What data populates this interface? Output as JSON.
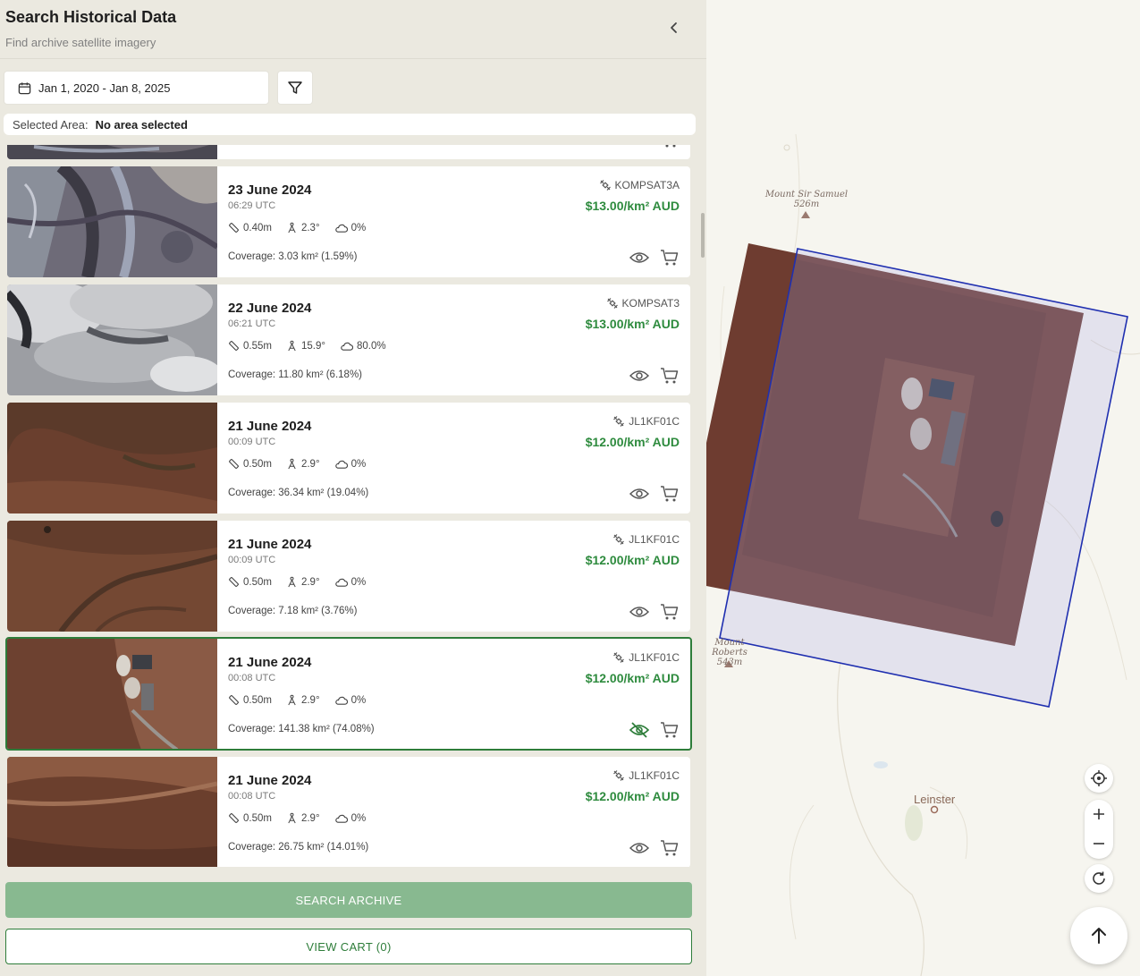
{
  "header": {
    "title": "Search Historical Data",
    "subtitle": "Find archive satellite imagery"
  },
  "filters": {
    "date_range": "Jan 1, 2020 - Jan 8, 2025",
    "selected_area_label": "Selected Area:",
    "selected_area_value": "No area selected"
  },
  "results": [
    {
      "date": "23 June 2024",
      "time": "06:29 UTC",
      "resolution": "0.40m",
      "angle": "2.3°",
      "cloud": "0%",
      "coverage": "Coverage: 3.03 km² (1.59%)",
      "satellite": "KOMPSAT3A",
      "price": "$13.00/km² AUD",
      "visible": true
    },
    {
      "date": "22 June 2024",
      "time": "06:21 UTC",
      "resolution": "0.55m",
      "angle": "15.9°",
      "cloud": "80.0%",
      "coverage": "Coverage: 11.80 km² (6.18%)",
      "satellite": "KOMPSAT3",
      "price": "$13.00/km² AUD",
      "visible": true
    },
    {
      "date": "21 June 2024",
      "time": "00:09 UTC",
      "resolution": "0.50m",
      "angle": "2.9°",
      "cloud": "0%",
      "coverage": "Coverage: 36.34 km² (19.04%)",
      "satellite": "JL1KF01C",
      "price": "$12.00/km² AUD",
      "visible": true
    },
    {
      "date": "21 June 2024",
      "time": "00:09 UTC",
      "resolution": "0.50m",
      "angle": "2.9°",
      "cloud": "0%",
      "coverage": "Coverage: 7.18 km² (3.76%)",
      "satellite": "JL1KF01C",
      "price": "$12.00/km² AUD",
      "visible": true
    },
    {
      "date": "21 June 2024",
      "time": "00:08 UTC",
      "resolution": "0.50m",
      "angle": "2.9°",
      "cloud": "0%",
      "coverage": "Coverage: 141.38 km² (74.08%)",
      "satellite": "JL1KF01C",
      "price": "$12.00/km² AUD",
      "visible": false,
      "selected": true
    },
    {
      "date": "21 June 2024",
      "time": "00:08 UTC",
      "resolution": "0.50m",
      "angle": "2.9°",
      "cloud": "0%",
      "coverage": "Coverage: 26.75 km² (14.01%)",
      "satellite": "JL1KF01C",
      "price": "$12.00/km² AUD",
      "visible": true
    }
  ],
  "buttons": {
    "search_archive": "SEARCH ARCHIVE",
    "view_cart": "VIEW CART (0)"
  },
  "map": {
    "labels": {
      "mount_sir_samuel": "Mount Sir Samuel",
      "mount_sir_samuel_elev": "526m",
      "mount_roberts": "Mount Roberts",
      "mount_roberts_elev": "543m",
      "leinster": "Leinster"
    },
    "footprint_color": "#1f2fb0",
    "icons": [
      "locate-icon",
      "zoom-in-icon",
      "zoom-out-icon",
      "reset-icon",
      "arrow-up-icon"
    ]
  },
  "colors": {
    "accent": "#2e7d3a",
    "price": "#2e8b3e",
    "search_button": "#88b990"
  }
}
